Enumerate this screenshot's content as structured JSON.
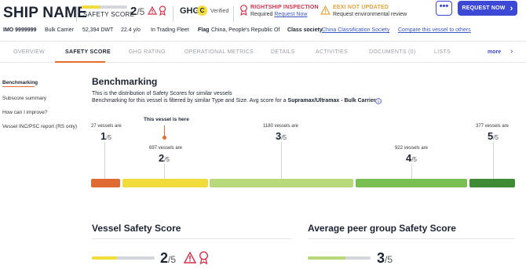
{
  "header": {
    "ship_name": "SHIP NAME",
    "safety_label": "SAFETY SCORE",
    "safety_score": "2",
    "safety_den": "/5",
    "safety_level": 0.4,
    "ghg_label": "GHG",
    "ghg_rating": "C",
    "ghg_verified": "Verified",
    "rightship_title": "RIGHTSHIP INSPECTION",
    "rightship_sub": "Required",
    "rightship_link": "Request Now",
    "eexi_title": "EEXI NOT UPDATED",
    "eexi_sub": "Request environmental review",
    "more_label": "•••",
    "request_label": "REQUEST NOW",
    "request_arrow": "›"
  },
  "info": {
    "imo": "IMO 9999999",
    "type": "Bulk Carrier",
    "dwt": "52,394 DWT",
    "age": "22.4 y/o",
    "status": "In Trading Fleet",
    "flag_label": "Flag",
    "flag_value": "China, People's Republic Of",
    "class_label": "Class society",
    "class_value": "China Classification Society",
    "compare_link": "Compare this vessel to others"
  },
  "tabs": [
    {
      "label": "OVERVIEW"
    },
    {
      "label": "SAFETY SCORE"
    },
    {
      "label": "GHG RATING"
    },
    {
      "label": "OPERATIONAL METRICS"
    },
    {
      "label": "DETAILS"
    },
    {
      "label": "ACTIVITIES"
    },
    {
      "label": "DOCUMENTS (0)"
    },
    {
      "label": "LISTS"
    }
  ],
  "tab_more": "more",
  "tab_more_arrow": "›",
  "sidebar": [
    {
      "label": "Benchmarking"
    },
    {
      "label": "Subscore summary"
    },
    {
      "label": "How can I improve?"
    },
    {
      "label": "Vessel INC/PSC report (RS only)"
    }
  ],
  "bench": {
    "title": "Benchmarking",
    "desc1": "This is the distribution of Safety Scores for similar vessels",
    "desc2_pre": "Benchmarking for this vessel is filtered by similar Type and Size. Avg score for a ",
    "desc2_bold": "Supramax/Ultramax - Bulk Carrier",
    "here_label": "This vessel is here",
    "groups": [
      {
        "count_label": "27 vessels are",
        "score": "1",
        "den": "/5"
      },
      {
        "count_label": "697 vessels are",
        "score": "2",
        "den": "/5"
      },
      {
        "count_label": "1180 vessels are",
        "score": "3",
        "den": "/5"
      },
      {
        "count_label": "922 vessels are",
        "score": "4",
        "den": "/5"
      },
      {
        "count_label": "377 vessels are",
        "score": "5",
        "den": "/5"
      }
    ],
    "colors": [
      "#e06b32",
      "#f2dc3b",
      "#b7d97a",
      "#79bf52",
      "#3f8a35"
    ]
  },
  "vessel_safety": {
    "title": "Vessel Safety Score",
    "score": "2",
    "den": "/5",
    "level": 0.4
  },
  "peer_safety": {
    "title": "Average peer group Safety Score",
    "score": "3",
    "den": "/5",
    "level": 0.6
  }
}
